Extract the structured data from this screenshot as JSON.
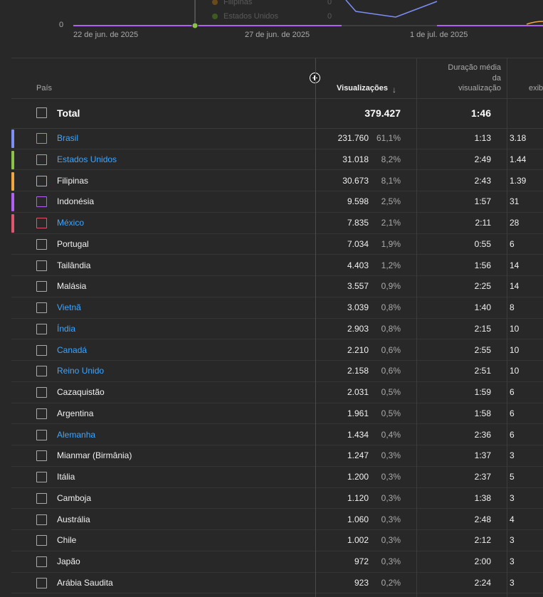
{
  "chart": {
    "zero_label": "0",
    "x_ticks": [
      "22 de jun. de 2025",
      "27 de jun. de 2025",
      "1 de jul. de 2025"
    ],
    "tooltip_rows": [
      {
        "name": "Filipinas",
        "value": "0",
        "color": "#f2a640"
      },
      {
        "name": "Estados Unidos",
        "value": "0",
        "color": "#8bc34a"
      }
    ],
    "marker_color": "#8bc34a"
  },
  "table": {
    "headers": {
      "country": "País",
      "views": "Visualizações",
      "duration_lines": [
        "Duração média",
        "da",
        "visualização"
      ],
      "extra": "exib"
    },
    "total": {
      "label": "Total",
      "views": "379.427",
      "duration": "1:46"
    },
    "rows": [
      {
        "country": "Brasil",
        "views": "231.760",
        "pct": "61,1%",
        "duration": "1:13",
        "extra": "3.18",
        "link": true,
        "color": "#7d8ff5"
      },
      {
        "country": "Estados Unidos",
        "views": "31.018",
        "pct": "8,2%",
        "duration": "2:49",
        "extra": "1.44",
        "link": true,
        "color": "#8bc34a"
      },
      {
        "country": "Filipinas",
        "views": "30.673",
        "pct": "8,1%",
        "duration": "2:43",
        "extra": "1.39",
        "link": false,
        "color": "#f2a640"
      },
      {
        "country": "Indonésia",
        "views": "9.598",
        "pct": "2,5%",
        "duration": "1:57",
        "extra": "31",
        "link": false,
        "color": "#b061f0"
      },
      {
        "country": "México",
        "views": "7.835",
        "pct": "2,1%",
        "duration": "2:11",
        "extra": "28",
        "link": true,
        "color": "#e0566d"
      },
      {
        "country": "Portugal",
        "views": "7.034",
        "pct": "1,9%",
        "duration": "0:55",
        "extra": "6",
        "link": false,
        "color": ""
      },
      {
        "country": "Tailândia",
        "views": "4.403",
        "pct": "1,2%",
        "duration": "1:56",
        "extra": "14",
        "link": false,
        "color": ""
      },
      {
        "country": "Malásia",
        "views": "3.557",
        "pct": "0,9%",
        "duration": "2:25",
        "extra": "14",
        "link": false,
        "color": ""
      },
      {
        "country": "Vietnã",
        "views": "3.039",
        "pct": "0,8%",
        "duration": "1:40",
        "extra": "8",
        "link": true,
        "color": ""
      },
      {
        "country": "Índia",
        "views": "2.903",
        "pct": "0,8%",
        "duration": "2:15",
        "extra": "10",
        "link": true,
        "color": ""
      },
      {
        "country": "Canadá",
        "views": "2.210",
        "pct": "0,6%",
        "duration": "2:55",
        "extra": "10",
        "link": true,
        "color": ""
      },
      {
        "country": "Reino Unido",
        "views": "2.158",
        "pct": "0,6%",
        "duration": "2:51",
        "extra": "10",
        "link": true,
        "color": ""
      },
      {
        "country": "Cazaquistão",
        "views": "2.031",
        "pct": "0,5%",
        "duration": "1:59",
        "extra": "6",
        "link": false,
        "color": ""
      },
      {
        "country": "Argentina",
        "views": "1.961",
        "pct": "0,5%",
        "duration": "1:58",
        "extra": "6",
        "link": false,
        "color": ""
      },
      {
        "country": "Alemanha",
        "views": "1.434",
        "pct": "0,4%",
        "duration": "2:36",
        "extra": "6",
        "link": true,
        "color": ""
      },
      {
        "country": "Mianmar (Birmânia)",
        "views": "1.247",
        "pct": "0,3%",
        "duration": "1:37",
        "extra": "3",
        "link": false,
        "color": ""
      },
      {
        "country": "Itália",
        "views": "1.200",
        "pct": "0,3%",
        "duration": "2:37",
        "extra": "5",
        "link": false,
        "color": ""
      },
      {
        "country": "Camboja",
        "views": "1.120",
        "pct": "0,3%",
        "duration": "1:38",
        "extra": "3",
        "link": false,
        "color": ""
      },
      {
        "country": "Austrália",
        "views": "1.060",
        "pct": "0,3%",
        "duration": "2:48",
        "extra": "4",
        "link": false,
        "color": ""
      },
      {
        "country": "Chile",
        "views": "1.002",
        "pct": "0,3%",
        "duration": "2:12",
        "extra": "3",
        "link": false,
        "color": ""
      },
      {
        "country": "Japão",
        "views": "972",
        "pct": "0,3%",
        "duration": "2:00",
        "extra": "3",
        "link": false,
        "color": ""
      },
      {
        "country": "Arábia Saudita",
        "views": "923",
        "pct": "0,2%",
        "duration": "2:24",
        "extra": "3",
        "link": false,
        "color": ""
      }
    ]
  },
  "colors": {
    "link": "#3ea6ff",
    "background": "#282828"
  }
}
